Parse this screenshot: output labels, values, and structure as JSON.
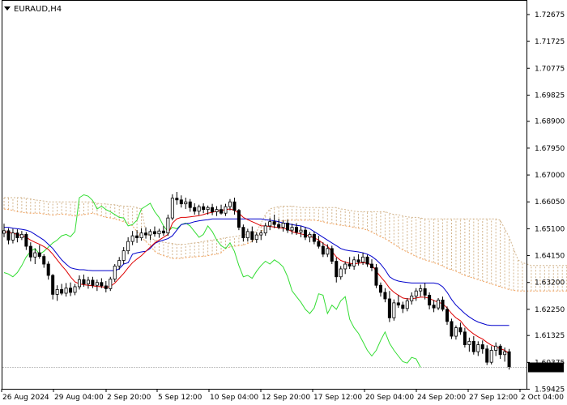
{
  "chart_data": {
    "type": "candlestick",
    "symbol_label": "EURAUD,H4",
    "y_range": [
      1.5944,
      1.7316
    ],
    "y_ticks": [
      "1.72675",
      "1.71725",
      "1.70775",
      "1.69825",
      "1.68900",
      "1.67950",
      "1.67000",
      "1.66050",
      "1.65100",
      "1.64150",
      "1.63200",
      "1.62250",
      "1.61325",
      "1.60375",
      "1.59425"
    ],
    "x_labels": [
      "26 Aug 2024",
      "29 Aug 04:00",
      "2 Sep 20:00",
      "5 Sep 12:00",
      "10 Sep 04:00",
      "12 Sep 20:00",
      "17 Sep 12:00",
      "20 Sep 04:00",
      "24 Sep 20:00",
      "27 Sep 12:00",
      "2 Oct 04:00"
    ],
    "current_price": "1.60198",
    "candles": [
      [
        1.6494,
        1.6528,
        1.648,
        1.6503
      ],
      [
        1.6503,
        1.6512,
        1.6455,
        1.647
      ],
      [
        1.647,
        1.651,
        1.6458,
        1.6495
      ],
      [
        1.6495,
        1.6508,
        1.6462,
        1.6478
      ],
      [
        1.6478,
        1.6502,
        1.647,
        1.649
      ],
      [
        1.649,
        1.6498,
        1.6435,
        1.6448
      ],
      [
        1.6448,
        1.6462,
        1.6395,
        1.641
      ],
      [
        1.641,
        1.644,
        1.6385,
        1.6425
      ],
      [
        1.6425,
        1.6452,
        1.6404,
        1.6412
      ],
      [
        1.6412,
        1.642,
        1.6372,
        1.6385
      ],
      [
        1.6385,
        1.6395,
        1.633,
        1.6345
      ],
      [
        1.6345,
        1.635,
        1.626,
        1.6278
      ],
      [
        1.6278,
        1.631,
        1.6255,
        1.6295
      ],
      [
        1.6295,
        1.6315,
        1.6275,
        1.6282
      ],
      [
        1.6282,
        1.6318,
        1.627,
        1.63
      ],
      [
        1.63,
        1.632,
        1.6272,
        1.6285
      ],
      [
        1.6285,
        1.6315,
        1.6275,
        1.6305
      ],
      [
        1.6305,
        1.6345,
        1.6295,
        1.633
      ],
      [
        1.633,
        1.6348,
        1.6305,
        1.6315
      ],
      [
        1.6315,
        1.634,
        1.6298,
        1.6328
      ],
      [
        1.6328,
        1.634,
        1.63,
        1.631
      ],
      [
        1.631,
        1.633,
        1.629,
        1.632
      ],
      [
        1.632,
        1.6335,
        1.63,
        1.6308
      ],
      [
        1.6308,
        1.6325,
        1.6285,
        1.6298
      ],
      [
        1.6298,
        1.634,
        1.629,
        1.6332
      ],
      [
        1.6332,
        1.6385,
        1.6322,
        1.6378
      ],
      [
        1.6378,
        1.641,
        1.6365,
        1.6398
      ],
      [
        1.6398,
        1.6445,
        1.6385,
        1.6432
      ],
      [
        1.6432,
        1.648,
        1.642,
        1.6465
      ],
      [
        1.6465,
        1.6502,
        1.6452,
        1.6485
      ],
      [
        1.6485,
        1.6505,
        1.646,
        1.6478
      ],
      [
        1.6478,
        1.6512,
        1.6468,
        1.6495
      ],
      [
        1.6495,
        1.6515,
        1.6475,
        1.6488
      ],
      [
        1.6488,
        1.6508,
        1.647,
        1.65
      ],
      [
        1.65,
        1.6518,
        1.6482,
        1.6492
      ],
      [
        1.6492,
        1.651,
        1.6478,
        1.6502
      ],
      [
        1.6502,
        1.652,
        1.6485,
        1.6495
      ],
      [
        1.6495,
        1.656,
        1.6485,
        1.6548
      ],
      [
        1.6548,
        1.6632,
        1.654,
        1.6618
      ],
      [
        1.6618,
        1.664,
        1.6595,
        1.6612
      ],
      [
        1.6612,
        1.6628,
        1.6585,
        1.6598
      ],
      [
        1.6598,
        1.662,
        1.658,
        1.6605
      ],
      [
        1.6605,
        1.6615,
        1.657,
        1.6585
      ],
      [
        1.6585,
        1.66,
        1.656,
        1.6572
      ],
      [
        1.6572,
        1.6595,
        1.6558,
        1.6588
      ],
      [
        1.6588,
        1.66,
        1.6565,
        1.6578
      ],
      [
        1.6578,
        1.6592,
        1.656,
        1.6585
      ],
      [
        1.6585,
        1.6598,
        1.6558,
        1.657
      ],
      [
        1.657,
        1.659,
        1.6555,
        1.6578
      ],
      [
        1.6578,
        1.6595,
        1.656,
        1.6565
      ],
      [
        1.6565,
        1.6598,
        1.6555,
        1.6588
      ],
      [
        1.6588,
        1.6615,
        1.6575,
        1.6605
      ],
      [
        1.6605,
        1.662,
        1.656,
        1.6575
      ],
      [
        1.6575,
        1.658,
        1.6505,
        1.6515
      ],
      [
        1.6515,
        1.6525,
        1.6465,
        1.6478
      ],
      [
        1.6478,
        1.651,
        1.6465,
        1.65
      ],
      [
        1.65,
        1.6518,
        1.6462,
        1.6472
      ],
      [
        1.6472,
        1.6498,
        1.646,
        1.6488
      ],
      [
        1.6488,
        1.6505,
        1.647,
        1.6495
      ],
      [
        1.6495,
        1.653,
        1.6485,
        1.652
      ],
      [
        1.652,
        1.6548,
        1.6505,
        1.6535
      ],
      [
        1.6535,
        1.656,
        1.6512,
        1.6525
      ],
      [
        1.6525,
        1.6545,
        1.6508,
        1.6515
      ],
      [
        1.6515,
        1.654,
        1.65,
        1.653
      ],
      [
        1.653,
        1.6542,
        1.6495,
        1.6505
      ],
      [
        1.6505,
        1.6528,
        1.649,
        1.6515
      ],
      [
        1.6515,
        1.653,
        1.6488,
        1.6498
      ],
      [
        1.6498,
        1.652,
        1.648,
        1.6505
      ],
      [
        1.6505,
        1.6515,
        1.647,
        1.648
      ],
      [
        1.648,
        1.6498,
        1.6462,
        1.649
      ],
      [
        1.649,
        1.65,
        1.6455,
        1.6465
      ],
      [
        1.6465,
        1.6485,
        1.644,
        1.6448
      ],
      [
        1.6448,
        1.6462,
        1.641,
        1.642
      ],
      [
        1.642,
        1.6455,
        1.641,
        1.644
      ],
      [
        1.644,
        1.645,
        1.6385,
        1.6395
      ],
      [
        1.6395,
        1.6408,
        1.632,
        1.634
      ],
      [
        1.634,
        1.6378,
        1.633,
        1.6368
      ],
      [
        1.6368,
        1.6395,
        1.635,
        1.6385
      ],
      [
        1.6385,
        1.641,
        1.6368,
        1.6378
      ],
      [
        1.6378,
        1.6412,
        1.6365,
        1.64
      ],
      [
        1.64,
        1.642,
        1.638,
        1.6392
      ],
      [
        1.6392,
        1.6425,
        1.6382,
        1.641
      ],
      [
        1.641,
        1.6418,
        1.6375,
        1.6385
      ],
      [
        1.6385,
        1.6402,
        1.636,
        1.6372
      ],
      [
        1.6372,
        1.6385,
        1.63,
        1.631
      ],
      [
        1.631,
        1.632,
        1.627,
        1.6285
      ],
      [
        1.6285,
        1.63,
        1.625,
        1.6262
      ],
      [
        1.6262,
        1.629,
        1.618,
        1.6195
      ],
      [
        1.6195,
        1.626,
        1.6185,
        1.6248
      ],
      [
        1.6248,
        1.6275,
        1.623,
        1.624
      ],
      [
        1.624,
        1.6252,
        1.6212,
        1.6228
      ],
      [
        1.6228,
        1.6265,
        1.6218,
        1.6255
      ],
      [
        1.6255,
        1.6285,
        1.6242,
        1.6272
      ],
      [
        1.6272,
        1.63,
        1.6255,
        1.629
      ],
      [
        1.629,
        1.6312,
        1.627,
        1.6298
      ],
      [
        1.6298,
        1.6318,
        1.626,
        1.6275
      ],
      [
        1.6275,
        1.6285,
        1.6225,
        1.624
      ],
      [
        1.624,
        1.6258,
        1.6215,
        1.623
      ],
      [
        1.623,
        1.6265,
        1.6222,
        1.6258
      ],
      [
        1.6258,
        1.627,
        1.6218,
        1.6225
      ],
      [
        1.6225,
        1.6235,
        1.617,
        1.6182
      ],
      [
        1.6182,
        1.6192,
        1.612,
        1.613
      ],
      [
        1.613,
        1.6168,
        1.6118,
        1.616
      ],
      [
        1.616,
        1.6178,
        1.6135,
        1.6145
      ],
      [
        1.6145,
        1.616,
        1.609,
        1.61
      ],
      [
        1.61,
        1.6125,
        1.6075,
        1.6112
      ],
      [
        1.6112,
        1.613,
        1.6065,
        1.6075
      ],
      [
        1.6075,
        1.6112,
        1.606,
        1.61
      ],
      [
        1.61,
        1.6115,
        1.6068,
        1.6085
      ],
      [
        1.6085,
        1.6098,
        1.6028,
        1.6038
      ],
      [
        1.6038,
        1.6095,
        1.603,
        1.608
      ],
      [
        1.608,
        1.6108,
        1.606,
        1.6095
      ],
      [
        1.6095,
        1.6102,
        1.605,
        1.6065
      ],
      [
        1.6065,
        1.609,
        1.604,
        1.6075
      ],
      [
        1.6075,
        1.6085,
        1.6012,
        1.602
      ]
    ],
    "tenkan": [
      1.65,
      1.6497,
      1.6494,
      1.649,
      1.6486,
      1.648,
      1.647,
      1.6462,
      1.6455,
      1.6447,
      1.6437,
      1.642,
      1.64,
      1.638,
      1.6362,
      1.634,
      1.6322,
      1.6315,
      1.6312,
      1.631,
      1.6308,
      1.6306,
      1.6305,
      1.6303,
      1.6306,
      1.6318,
      1.6335,
      1.6352,
      1.6372,
      1.639,
      1.6403,
      1.6415,
      1.643,
      1.6445,
      1.646,
      1.647,
      1.648,
      1.649,
      1.653,
      1.6545,
      1.655,
      1.655,
      1.6552,
      1.6554,
      1.6556,
      1.656,
      1.6565,
      1.6568,
      1.6572,
      1.6575,
      1.6578,
      1.658,
      1.6575,
      1.6565,
      1.655,
      1.6542,
      1.6535,
      1.6528,
      1.652,
      1.652,
      1.6518,
      1.6516,
      1.6514,
      1.6512,
      1.6508,
      1.65,
      1.6495,
      1.6492,
      1.6488,
      1.6484,
      1.6478,
      1.647,
      1.6458,
      1.6448,
      1.643,
      1.641,
      1.6398,
      1.6392,
      1.6388,
      1.6386,
      1.6388,
      1.639,
      1.6388,
      1.6382,
      1.636,
      1.634,
      1.6322,
      1.63,
      1.6285,
      1.6275,
      1.6265,
      1.6262,
      1.6262,
      1.6265,
      1.6268,
      1.6268,
      1.6264,
      1.6256,
      1.625,
      1.6245,
      1.623,
      1.621,
      1.6195,
      1.6185,
      1.6165,
      1.615,
      1.6138,
      1.6128,
      1.612,
      1.6108,
      1.6098,
      1.6092,
      1.6086,
      1.608,
      1.6068
    ],
    "kijun": [
      1.6515,
      1.6515,
      1.6512,
      1.651,
      1.6508,
      1.6505,
      1.65,
      1.649,
      1.648,
      1.647,
      1.6455,
      1.644,
      1.642,
      1.64,
      1.6385,
      1.6372,
      1.6368,
      1.6365,
      1.6365,
      1.6363,
      1.6362,
      1.6362,
      1.6362,
      1.6362,
      1.6362,
      1.6362,
      1.6368,
      1.6385,
      1.639,
      1.642,
      1.6425,
      1.6428,
      1.643,
      1.644,
      1.6458,
      1.6465,
      1.647,
      1.6475,
      1.6485,
      1.6505,
      1.6525,
      1.6528,
      1.653,
      1.6535,
      1.6538,
      1.654,
      1.6542,
      1.6545,
      1.6545,
      1.6545,
      1.6545,
      1.6545,
      1.6545,
      1.6545,
      1.6545,
      1.6545,
      1.6545,
      1.6545,
      1.6545,
      1.6542,
      1.654,
      1.6538,
      1.6535,
      1.653,
      1.6528,
      1.6525,
      1.6522,
      1.652,
      1.6515,
      1.651,
      1.65,
      1.649,
      1.648,
      1.647,
      1.646,
      1.645,
      1.644,
      1.6435,
      1.6432,
      1.643,
      1.6428,
      1.6425,
      1.642,
      1.6412,
      1.64,
      1.6385,
      1.6365,
      1.634,
      1.633,
      1.6325,
      1.6322,
      1.632,
      1.6318,
      1.6318,
      1.6318,
      1.6318,
      1.6318,
      1.6318,
      1.6315,
      1.6305,
      1.6285,
      1.626,
      1.624,
      1.6225,
      1.621,
      1.6198,
      1.6188,
      1.618,
      1.6175,
      1.617,
      1.6168,
      1.6168,
      1.6168,
      1.6168,
      1.6168
    ],
    "chikou": [
      1.6355,
      1.635,
      1.634,
      1.6355,
      1.638,
      1.641,
      1.643,
      1.644,
      1.642,
      1.643,
      1.6445,
      1.646,
      1.647,
      1.6485,
      1.649,
      1.6482,
      1.65,
      1.662,
      1.663,
      1.6625,
      1.661,
      1.658,
      1.659,
      1.6578,
      1.657,
      1.656,
      1.655,
      1.6548,
      1.652,
      1.6525,
      1.654,
      1.658,
      1.659,
      1.66,
      1.657,
      1.655,
      1.652,
      1.65,
      1.6515,
      1.651,
      1.6525,
      1.653,
      1.652,
      1.65,
      1.648,
      1.649,
      1.652,
      1.65,
      1.647,
      1.645,
      1.644,
      1.646,
      1.643,
      1.638,
      1.634,
      1.6345,
      1.6335,
      1.636,
      1.638,
      1.6395,
      1.6385,
      1.64,
      1.639,
      1.6375,
      1.634,
      1.629,
      1.627,
      1.625,
      1.6225,
      1.621,
      1.623,
      1.628,
      1.6275,
      1.621,
      1.624,
      1.6225,
      1.6255,
      1.627,
      1.619,
      1.616,
      1.614,
      1.611,
      1.608,
      1.606,
      1.608,
      1.6115,
      1.6145,
      1.6105,
      1.608,
      1.606,
      1.604,
      1.6035,
      1.6055,
      1.605,
      1.602
    ],
    "senkou_a": [
      1.658,
      1.6578,
      1.6575,
      1.657,
      1.6568,
      1.6566,
      1.6565,
      1.6565,
      1.6565,
      1.6562,
      1.656,
      1.6558,
      1.656,
      1.6562,
      1.656,
      1.6558,
      1.6555,
      1.6558,
      1.656,
      1.6562,
      1.6565,
      1.656,
      1.6555,
      1.655,
      1.6548,
      1.6545,
      1.654,
      1.6535,
      1.653,
      1.652,
      1.65,
      1.648,
      1.6465,
      1.645,
      1.643,
      1.642,
      1.6415,
      1.641,
      1.6405,
      1.6405,
      1.6405,
      1.6408,
      1.641,
      1.641,
      1.6412,
      1.6412,
      1.6415,
      1.6418,
      1.642,
      1.6425,
      1.644,
      1.6445,
      1.6448,
      1.645,
      1.6452,
      1.6458,
      1.6465,
      1.648,
      1.65,
      1.6515,
      1.6525,
      1.653,
      1.6535,
      1.6538,
      1.654,
      1.654,
      1.654,
      1.654,
      1.654,
      1.654,
      1.654,
      1.6538,
      1.6535,
      1.653,
      1.6528,
      1.6525,
      1.6522,
      1.652,
      1.6518,
      1.6515,
      1.6512,
      1.651,
      1.6505,
      1.6498,
      1.649,
      1.6482,
      1.6475,
      1.6465,
      1.6455,
      1.6445,
      1.6435,
      1.6428,
      1.642,
      1.6412,
      1.6405,
      1.64,
      1.6395,
      1.639,
      1.6385,
      1.6378,
      1.637,
      1.6365,
      1.636,
      1.6352,
      1.6345,
      1.634,
      1.6335,
      1.633,
      1.6325,
      1.632,
      1.6315,
      1.631,
      1.6305,
      1.63,
      1.6295,
      1.6292,
      1.629,
      1.629,
      1.629,
      1.629,
      1.629,
      1.629,
      1.629,
      1.629,
      1.629,
      1.629,
      1.629,
      1.629,
      1.629,
      1.629,
      1.629,
      1.629,
      1.629,
      1.629,
      1.629,
      1.629,
      1.629,
      1.629
    ],
    "senkou_b": [
      1.662,
      1.662,
      1.662,
      1.662,
      1.662,
      1.6618,
      1.6615,
      1.6612,
      1.661,
      1.6608,
      1.6605,
      1.6605,
      1.6605,
      1.6605,
      1.6605,
      1.6605,
      1.6605,
      1.6605,
      1.6605,
      1.6605,
      1.6605,
      1.66,
      1.6598,
      1.6598,
      1.6595,
      1.6595,
      1.6592,
      1.659,
      1.659,
      1.6588,
      1.6585,
      1.658,
      1.65,
      1.648,
      1.647,
      1.6465,
      1.6462,
      1.646,
      1.6458,
      1.6455,
      1.6455,
      1.6455,
      1.6458,
      1.646,
      1.6462,
      1.6465,
      1.6468,
      1.647,
      1.6472,
      1.6475,
      1.6478,
      1.648,
      1.6482,
      1.6485,
      1.6488,
      1.649,
      1.6495,
      1.65,
      1.653,
      1.656,
      1.658,
      1.6585,
      1.6588,
      1.659,
      1.659,
      1.659,
      1.6588,
      1.6585,
      1.6585,
      1.6585,
      1.6585,
      1.6585,
      1.6585,
      1.6585,
      1.6585,
      1.6585,
      1.658,
      1.6578,
      1.6575,
      1.6572,
      1.657,
      1.657,
      1.657,
      1.657,
      1.657,
      1.657,
      1.657,
      1.6565,
      1.656,
      1.656,
      1.6555,
      1.6552,
      1.655,
      1.655,
      1.6548,
      1.6545,
      1.6545,
      1.6545,
      1.6545,
      1.6545,
      1.6545,
      1.6545,
      1.6545,
      1.6545,
      1.6545,
      1.6545,
      1.6545,
      1.6545,
      1.6545,
      1.6545,
      1.6545,
      1.6545,
      1.654,
      1.651,
      1.648,
      1.644,
      1.64,
      1.639,
      1.6385,
      1.638,
      1.638,
      1.638,
      1.638,
      1.638,
      1.638,
      1.638,
      1.638,
      1.638,
      1.638,
      1.638,
      1.638,
      1.638,
      1.638,
      1.638,
      1.638,
      1.638,
      1.638,
      1.638,
      1.638,
      1.638
    ],
    "colors": {
      "bull_body": "#ffffff",
      "bear_body": "#000000",
      "wick": "#000000",
      "tenkan": "#dd0000",
      "kijun": "#0000cc",
      "chikou": "#33dd33",
      "senkou_a": "#f4a460",
      "senkou_b": "#d2b48c",
      "frame": "#000000",
      "price_line": "#c0c0c0"
    }
  }
}
